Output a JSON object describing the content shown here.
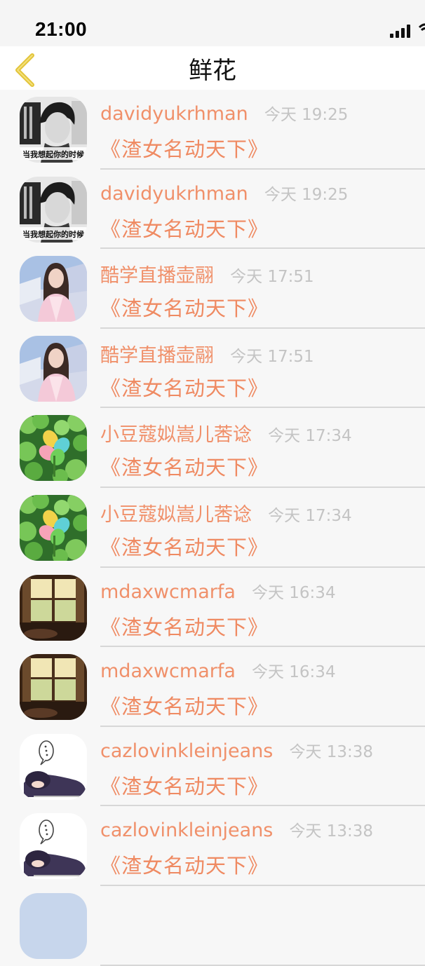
{
  "status_bar": {
    "time": "21:00"
  },
  "nav": {
    "title": "鲜花",
    "back_icon": "chevron-left-icon"
  },
  "colors": {
    "accent": "#ef8a62",
    "time_gray": "#c4c4c4",
    "back_yellow": "#e2c43a"
  },
  "rows": [
    {
      "user": "davidyukrhman",
      "time": "今天 19:25",
      "message": "《渣女名动天下》",
      "avatar": "boy",
      "avatar_caption": "当我想起你的时候"
    },
    {
      "user": "davidyukrhman",
      "time": "今天 19:25",
      "message": "《渣女名动天下》",
      "avatar": "boy",
      "avatar_caption": "当我想起你的时候"
    },
    {
      "user": "酷学直播壶翮",
      "time": "今天 17:51",
      "message": "《渣女名动天下》",
      "avatar": "girl"
    },
    {
      "user": "酷学直播壶翮",
      "time": "今天 17:51",
      "message": "《渣女名动天下》",
      "avatar": "girl"
    },
    {
      "user": "小豆蔻姒嵩儿莕谂",
      "time": "今天 17:34",
      "message": "《渣女名动天下》",
      "avatar": "clover"
    },
    {
      "user": "小豆蔻姒嵩儿莕谂",
      "time": "今天 17:34",
      "message": "《渣女名动天下》",
      "avatar": "clover"
    },
    {
      "user": "mdaxwcmarfa",
      "time": "今天 16:34",
      "message": "《渣女名动天下》",
      "avatar": "window"
    },
    {
      "user": "mdaxwcmarfa",
      "time": "今天 16:34",
      "message": "《渣女名动天下》",
      "avatar": "window"
    },
    {
      "user": "cazlovinkleinjeans",
      "time": "今天 13:38",
      "message": "《渣女名动天下》",
      "avatar": "sleepy"
    },
    {
      "user": "cazlovinkleinjeans",
      "time": "今天 13:38",
      "message": "《渣女名动天下》",
      "avatar": "sleepy"
    },
    {
      "user": "",
      "time": "",
      "message": "",
      "avatar": "blue"
    }
  ]
}
